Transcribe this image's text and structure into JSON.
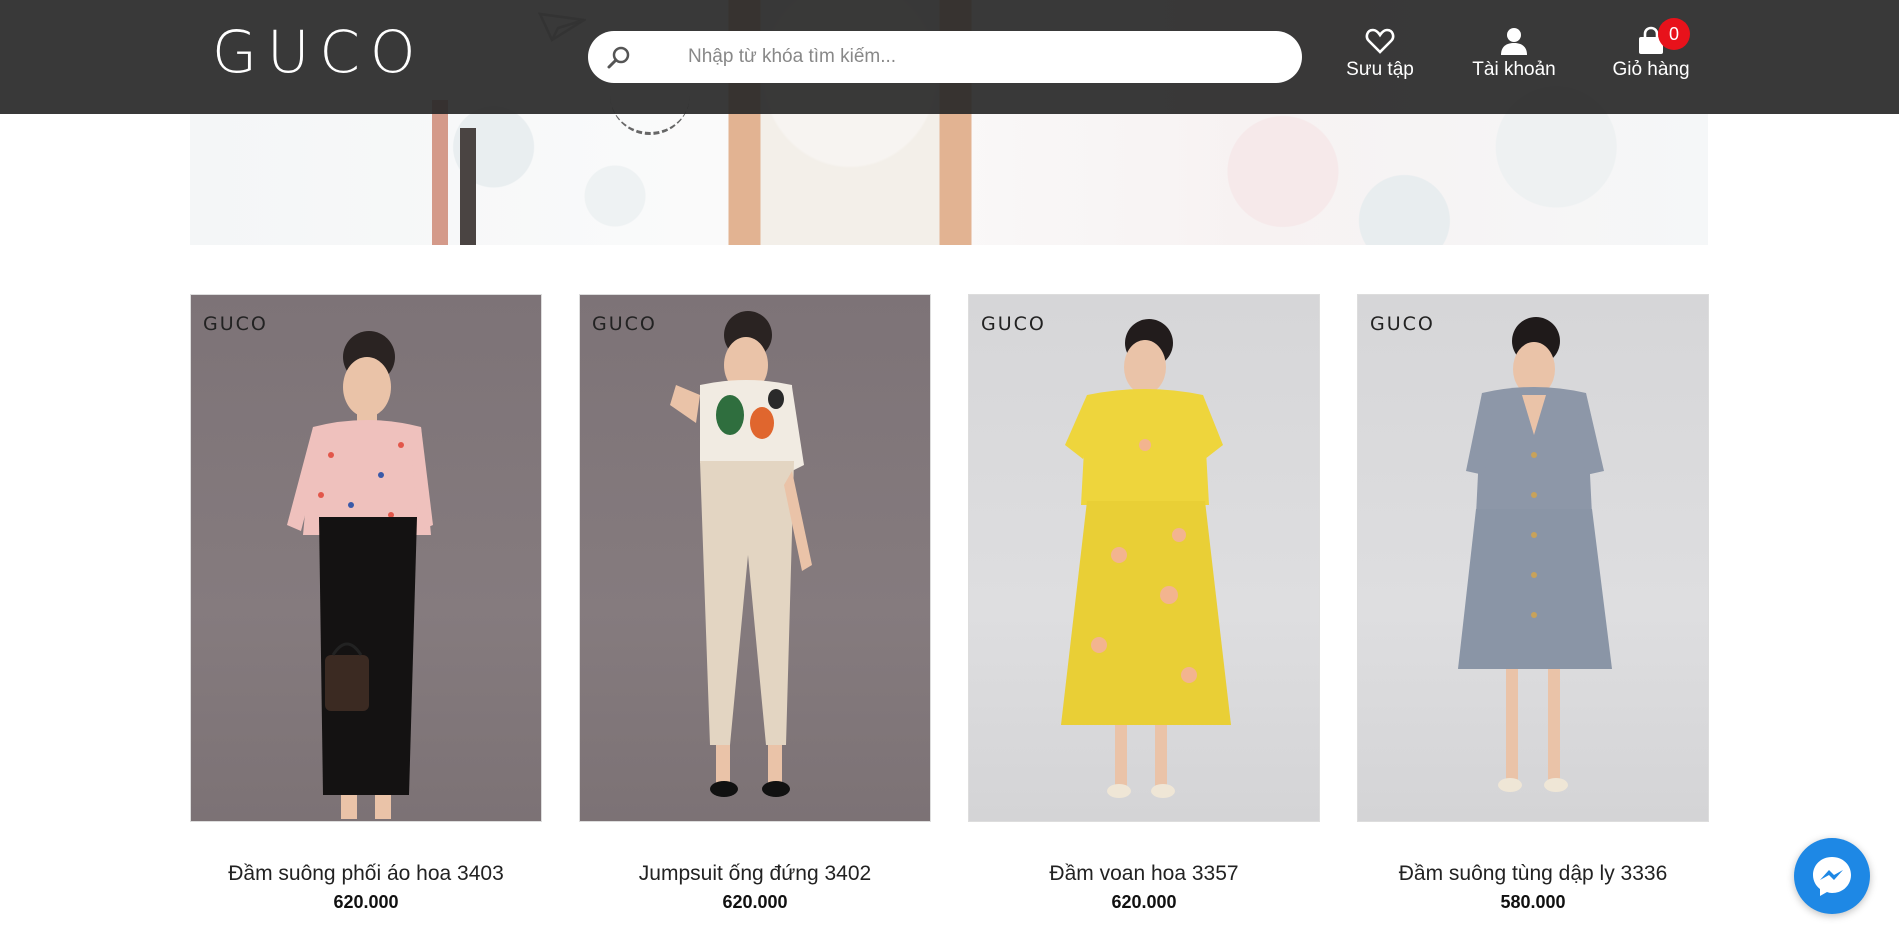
{
  "header": {
    "logo_text": "GUCO",
    "search": {
      "placeholder": "Nhập từ khóa tìm kiếm..."
    },
    "nav": {
      "collection_label": "Sưu tập",
      "account_label": "Tài khoản",
      "cart_label": "Giỏ hàng",
      "cart_count": "0"
    }
  },
  "products": [
    {
      "name": "Đầm suông phối áo hoa 3403",
      "price": "620.000",
      "brand_mark": "GUCO"
    },
    {
      "name": "Jumpsuit ống đứng 3402",
      "price": "620.000",
      "brand_mark": "GUCO"
    },
    {
      "name": "Đầm voan hoa 3357",
      "price": "620.000",
      "brand_mark": "GUCO"
    },
    {
      "name": "Đầm suông tùng dập ly 3336",
      "price": "580.000",
      "brand_mark": "GUCO"
    }
  ],
  "icons": {
    "search": "search-icon",
    "collection": "heart-icon",
    "account": "user-icon",
    "cart": "shopping-bag-icon",
    "chat": "messenger-icon"
  },
  "colors": {
    "header_bg": "#282828",
    "cart_badge": "#e8121b",
    "messenger": "#1e88e5"
  }
}
